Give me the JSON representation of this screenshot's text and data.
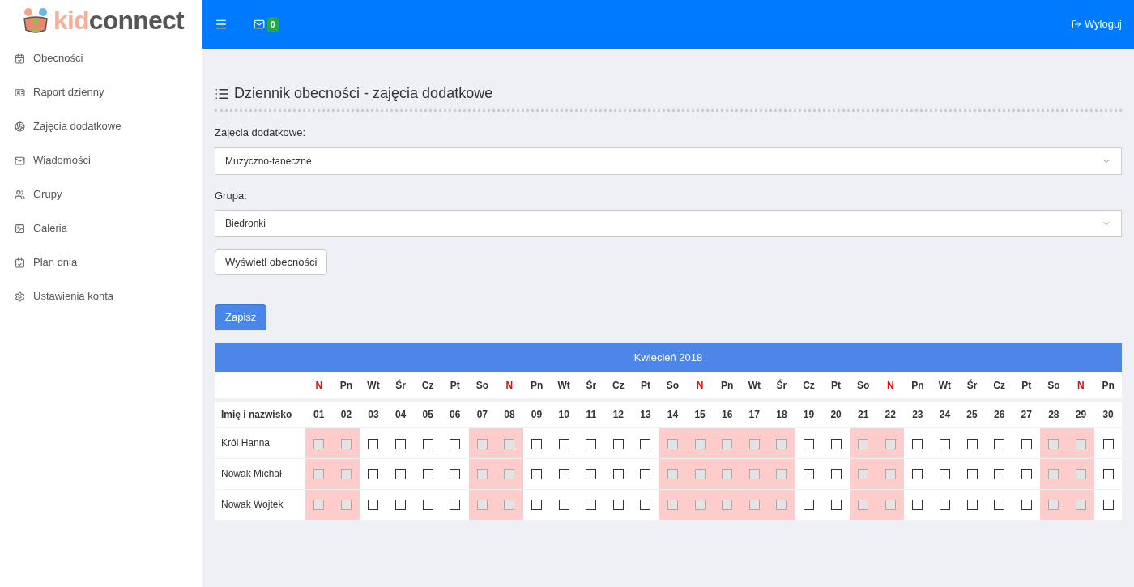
{
  "logo": {
    "part_1": "kid",
    "part_2": "connect"
  },
  "topbar": {
    "message_count": "0",
    "logout": "Wyloguj"
  },
  "sidebar": {
    "items": [
      {
        "label": "Obecności"
      },
      {
        "label": "Raport dzienny"
      },
      {
        "label": "Zajęcia dodatkowe"
      },
      {
        "label": "Wiadomości"
      },
      {
        "label": "Grupy"
      },
      {
        "label": "Galeria"
      },
      {
        "label": "Plan dnia"
      },
      {
        "label": "Ustawienia konta"
      }
    ]
  },
  "page": {
    "title": "Dziennik obecności - zajęcia dodatkowe",
    "activity_label": "Zajęcia dodatkowe:",
    "activity_value": "Muzyczno-taneczne",
    "group_label": "Grupa:",
    "group_value": "Biedronki",
    "show_button": "Wyświetl obecności",
    "save_button": "Zapisz"
  },
  "table": {
    "month": "Kwiecień 2018",
    "name_header": "Imię i nazwisko",
    "days": [
      {
        "weekday": "N",
        "day": "01",
        "sunday": true,
        "disabled": true
      },
      {
        "weekday": "Pn",
        "day": "02",
        "sunday": false,
        "disabled": true
      },
      {
        "weekday": "Wt",
        "day": "03",
        "sunday": false,
        "disabled": false
      },
      {
        "weekday": "Śr",
        "day": "04",
        "sunday": false,
        "disabled": false
      },
      {
        "weekday": "Cz",
        "day": "05",
        "sunday": false,
        "disabled": false
      },
      {
        "weekday": "Pt",
        "day": "06",
        "sunday": false,
        "disabled": false
      },
      {
        "weekday": "So",
        "day": "07",
        "sunday": false,
        "disabled": true
      },
      {
        "weekday": "N",
        "day": "08",
        "sunday": true,
        "disabled": true
      },
      {
        "weekday": "Pn",
        "day": "09",
        "sunday": false,
        "disabled": false
      },
      {
        "weekday": "Wt",
        "day": "10",
        "sunday": false,
        "disabled": false
      },
      {
        "weekday": "Śr",
        "day": "11",
        "sunday": false,
        "disabled": false
      },
      {
        "weekday": "Cz",
        "day": "12",
        "sunday": false,
        "disabled": false
      },
      {
        "weekday": "Pt",
        "day": "13",
        "sunday": false,
        "disabled": false
      },
      {
        "weekday": "So",
        "day": "14",
        "sunday": false,
        "disabled": true
      },
      {
        "weekday": "N",
        "day": "15",
        "sunday": true,
        "disabled": true
      },
      {
        "weekday": "Pn",
        "day": "16",
        "sunday": false,
        "disabled": true
      },
      {
        "weekday": "Wt",
        "day": "17",
        "sunday": false,
        "disabled": true
      },
      {
        "weekday": "Śr",
        "day": "18",
        "sunday": false,
        "disabled": true
      },
      {
        "weekday": "Cz",
        "day": "19",
        "sunday": false,
        "disabled": false
      },
      {
        "weekday": "Pt",
        "day": "20",
        "sunday": false,
        "disabled": false
      },
      {
        "weekday": "So",
        "day": "21",
        "sunday": false,
        "disabled": true
      },
      {
        "weekday": "N",
        "day": "22",
        "sunday": true,
        "disabled": true
      },
      {
        "weekday": "Pn",
        "day": "23",
        "sunday": false,
        "disabled": false
      },
      {
        "weekday": "Wt",
        "day": "24",
        "sunday": false,
        "disabled": false
      },
      {
        "weekday": "Śr",
        "day": "25",
        "sunday": false,
        "disabled": false
      },
      {
        "weekday": "Cz",
        "day": "26",
        "sunday": false,
        "disabled": false
      },
      {
        "weekday": "Pt",
        "day": "27",
        "sunday": false,
        "disabled": false
      },
      {
        "weekday": "So",
        "day": "28",
        "sunday": false,
        "disabled": true
      },
      {
        "weekday": "N",
        "day": "29",
        "sunday": true,
        "disabled": true
      },
      {
        "weekday": "Pn",
        "day": "30",
        "sunday": false,
        "disabled": false
      }
    ],
    "rows": [
      {
        "name": "Król Hanna",
        "checked": [
          false,
          false,
          false,
          false,
          false,
          false,
          false,
          false,
          false,
          false,
          false,
          false,
          false,
          false,
          false,
          false,
          false,
          false,
          false,
          false,
          false,
          false,
          false,
          false,
          false,
          false,
          false,
          false,
          false,
          false
        ]
      },
      {
        "name": "Nowak Michał",
        "checked": [
          false,
          false,
          false,
          false,
          false,
          false,
          false,
          false,
          false,
          false,
          false,
          false,
          false,
          false,
          false,
          false,
          false,
          false,
          false,
          false,
          false,
          false,
          false,
          false,
          false,
          false,
          false,
          false,
          false,
          false
        ]
      },
      {
        "name": "Nowak Wojtek",
        "checked": [
          false,
          false,
          false,
          false,
          false,
          false,
          false,
          false,
          false,
          false,
          false,
          false,
          false,
          false,
          false,
          false,
          false,
          false,
          false,
          false,
          false,
          false,
          false,
          false,
          false,
          false,
          false,
          false,
          false,
          false
        ]
      }
    ]
  }
}
